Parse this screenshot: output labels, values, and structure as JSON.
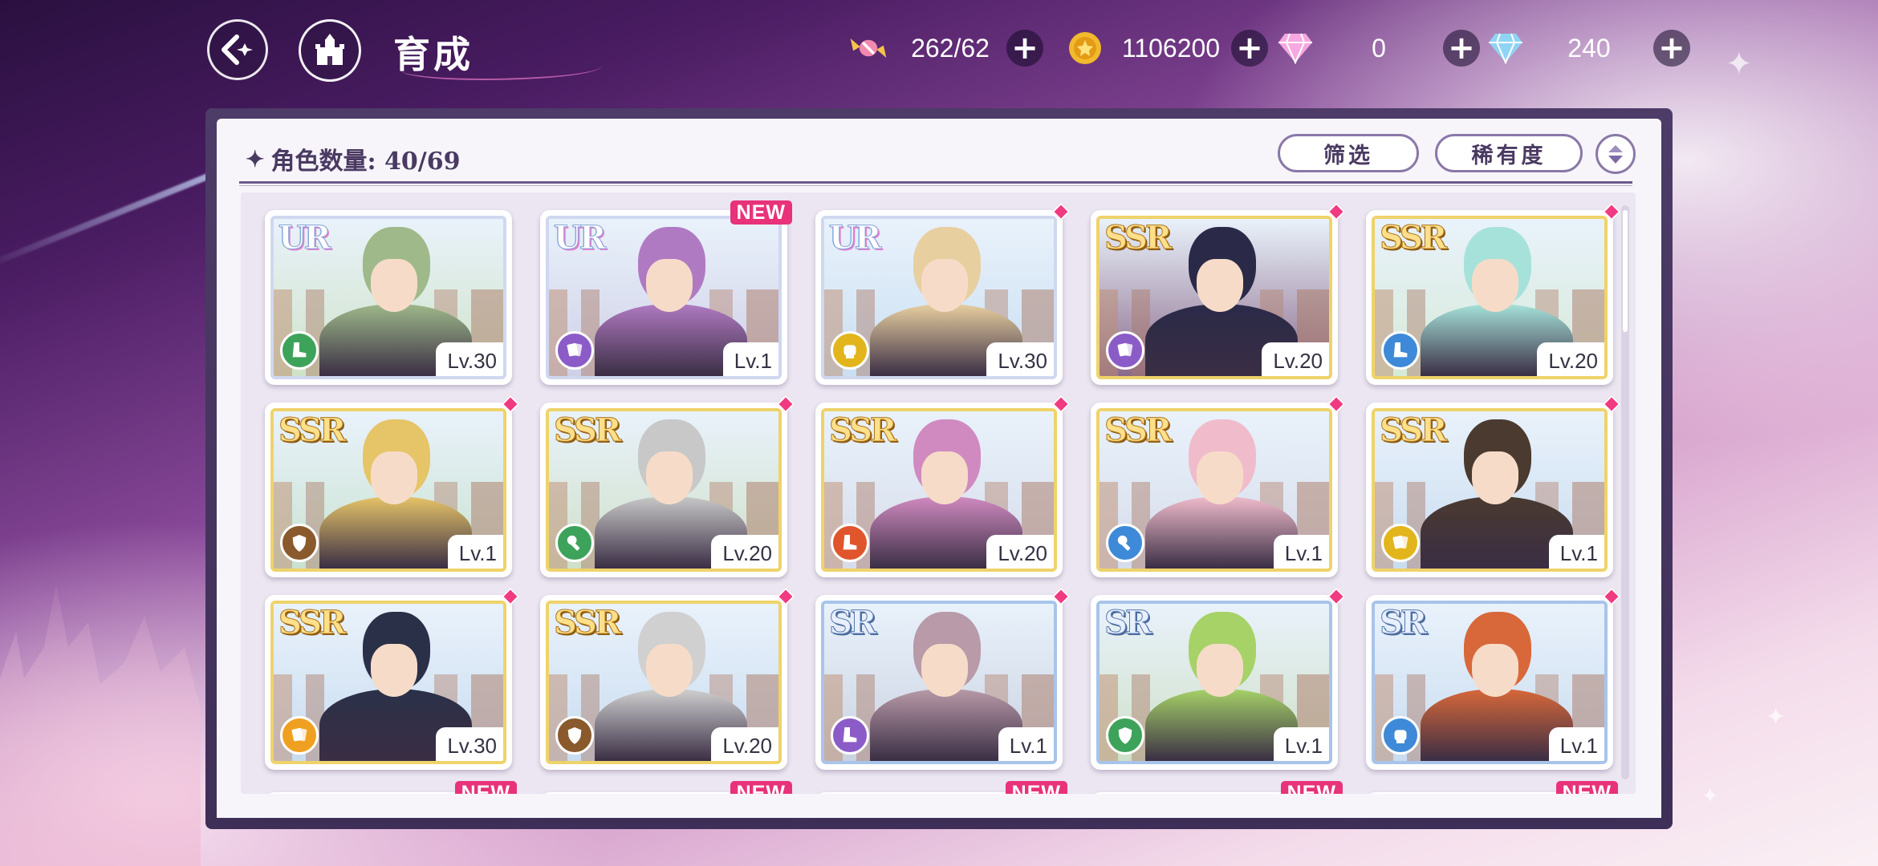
{
  "header": {
    "title": "育成",
    "back_icon": "back-arrow-icon",
    "home_icon": "castle-home-icon"
  },
  "resources": [
    {
      "icon": "candy-icon",
      "value": "262/62"
    },
    {
      "icon": "gold-coin-icon",
      "value": "1106200"
    },
    {
      "icon": "pink-gem-icon",
      "value": "0"
    },
    {
      "icon": "blue-gem-icon",
      "value": "240"
    }
  ],
  "panel": {
    "count_label": "角色数量: 40/69",
    "filter_label": "筛选",
    "rarity_label": "稀有度"
  },
  "colors": {
    "ur": "#cfd8ef",
    "ssr": "#efd36a",
    "sr": "#a8c4ea",
    "new_badge": "#e8327a",
    "panel_frame": "#4d3b68"
  },
  "cards": [
    {
      "rarity": "UR",
      "level": "Lv.30",
      "attr": "green",
      "attr_icon": "boot-icon",
      "marker": "none",
      "hair": "#9fb98a",
      "bg": "#cfe3c8"
    },
    {
      "rarity": "UR",
      "level": "Lv.1",
      "attr": "purple",
      "attr_icon": "cards-icon",
      "marker": "NEW",
      "hair": "#b07ac2",
      "bg": "#cfcfe6"
    },
    {
      "rarity": "UR",
      "level": "Lv.30",
      "attr": "yellow",
      "attr_icon": "fist-icon",
      "marker": "dot",
      "hair": "#e8cfa0",
      "bg": "#c9dff2"
    },
    {
      "rarity": "SSR",
      "level": "Lv.20",
      "attr": "purple",
      "attr_icon": "cards-icon",
      "marker": "dot",
      "hair": "#2a2a48",
      "bg": "#8a6a8a"
    },
    {
      "rarity": "SSR",
      "level": "Lv.20",
      "attr": "blue",
      "attr_icon": "boot-icon",
      "marker": "dot",
      "hair": "#a6e2da",
      "bg": "#d6ead8"
    },
    {
      "rarity": "SSR",
      "level": "Lv.1",
      "attr": "brown",
      "attr_icon": "shield-icon",
      "marker": "dot",
      "hair": "#e6c468",
      "bg": "#c9e2d0"
    },
    {
      "rarity": "SSR",
      "level": "Lv.20",
      "attr": "green",
      "attr_icon": "wrench-icon",
      "marker": "dot",
      "hair": "#c8c8c8",
      "bg": "#cfe0c8"
    },
    {
      "rarity": "SSR",
      "level": "Lv.20",
      "attr": "red",
      "attr_icon": "boot-icon",
      "marker": "dot",
      "hair": "#d08ac0",
      "bg": "#d6dcea"
    },
    {
      "rarity": "SSR",
      "level": "Lv.1",
      "attr": "blue",
      "attr_icon": "wrench-icon",
      "marker": "dot",
      "hair": "#f0bccc",
      "bg": "#d6dcea"
    },
    {
      "rarity": "SSR",
      "level": "Lv.1",
      "attr": "yellow",
      "attr_icon": "cards-icon",
      "marker": "dot",
      "hair": "#4a3a30",
      "bg": "#c9dcf0"
    },
    {
      "rarity": "SSR",
      "level": "Lv.30",
      "attr": "orange",
      "attr_icon": "cards-icon",
      "marker": "dot",
      "hair": "#2a3048",
      "bg": "#c9dcf0"
    },
    {
      "rarity": "SSR",
      "level": "Lv.20",
      "attr": "brown",
      "attr_icon": "shield-icon",
      "marker": "dot",
      "hair": "#d0d0d0",
      "bg": "#c9dcf0"
    },
    {
      "rarity": "SR",
      "level": "Lv.1",
      "attr": "purple",
      "attr_icon": "boot-icon",
      "marker": "dot",
      "hair": "#b89aa8",
      "bg": "#c9d2e0"
    },
    {
      "rarity": "SR",
      "level": "Lv.1",
      "attr": "green",
      "attr_icon": "shield-icon",
      "marker": "dot",
      "hair": "#a6d268",
      "bg": "#cfe0c8"
    },
    {
      "rarity": "SR",
      "level": "Lv.1",
      "attr": "blue",
      "attr_icon": "fist-icon",
      "marker": "dot",
      "hair": "#d8683a",
      "bg": "#c9dcf0"
    }
  ],
  "partial_row_badge": "NEW"
}
